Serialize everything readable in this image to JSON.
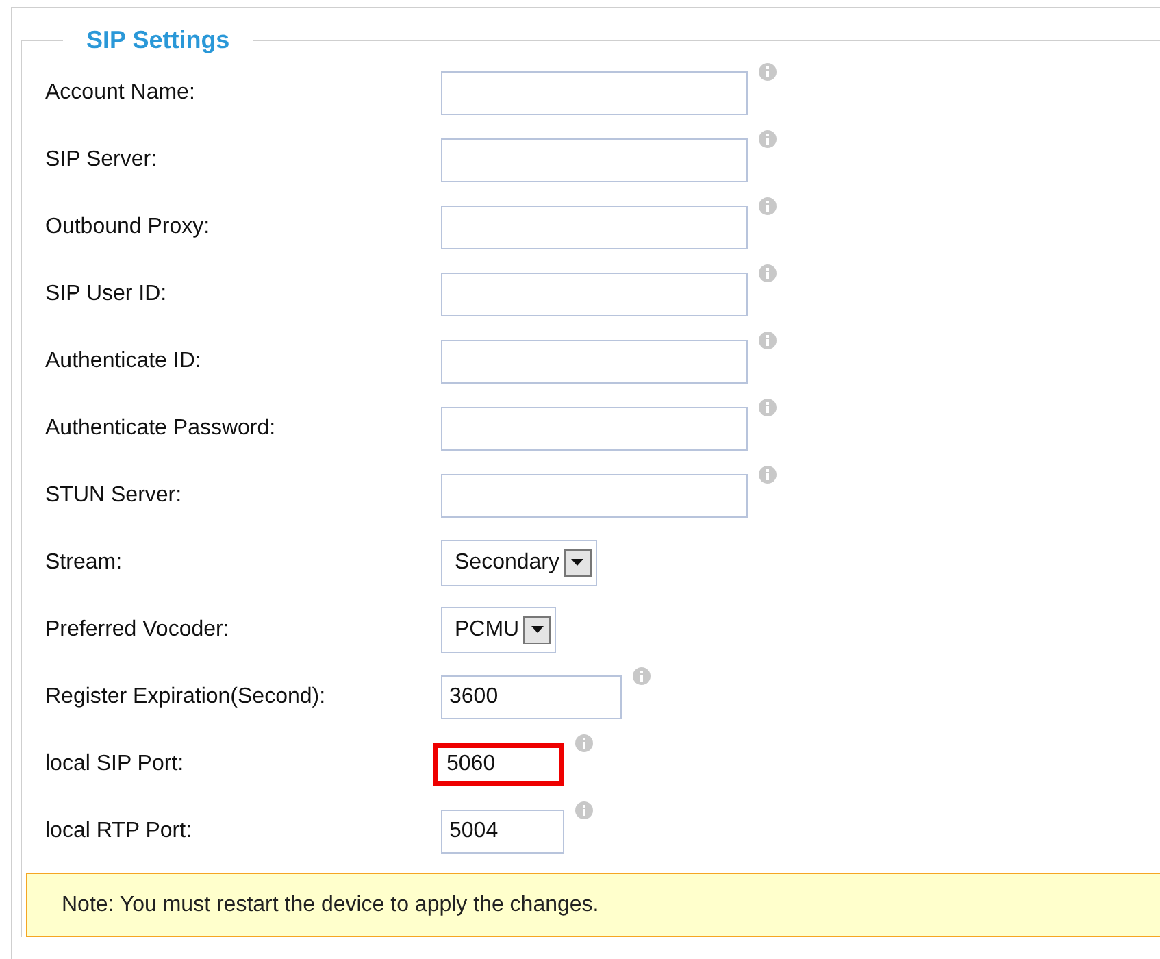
{
  "section": {
    "title": "SIP Settings"
  },
  "fields": [
    {
      "label": "Account Name:",
      "kind": "wide"
    },
    {
      "label": "SIP Server:",
      "kind": "wide"
    },
    {
      "label": "Outbound Proxy:",
      "kind": "wide"
    },
    {
      "label": "SIP User ID:",
      "kind": "wide"
    },
    {
      "label": "Authenticate ID:",
      "kind": "wide"
    },
    {
      "label": "Authenticate Password:",
      "kind": "wide"
    },
    {
      "label": "STUN Server:",
      "kind": "wide"
    },
    {
      "label": "Stream:",
      "kind": "select",
      "value": "Secondary"
    },
    {
      "label": "Preferred Vocoder:",
      "kind": "select",
      "value": "PCMU"
    },
    {
      "label": "Register Expiration(Second):",
      "kind": "medium",
      "value": "3600"
    },
    {
      "label": "local SIP Port:",
      "kind": "narrow",
      "value": "5060",
      "highlighted": true
    },
    {
      "label": "local RTP Port:",
      "kind": "narrow",
      "value": "5004"
    }
  ],
  "note": "Note: You must restart the device to apply the changes."
}
